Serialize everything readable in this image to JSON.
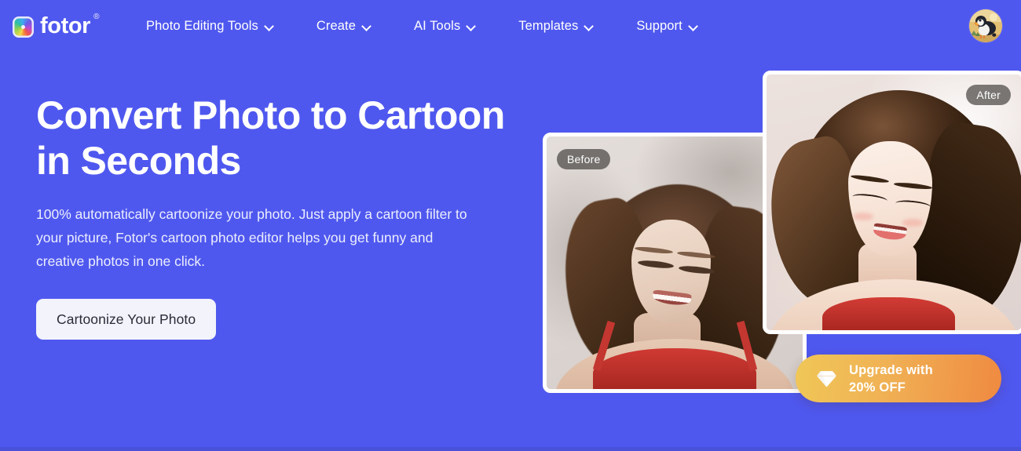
{
  "theme": {
    "background": "#4f58ee",
    "background_bottom_strip": "#4952d8",
    "cta_background": "#f2f3fb",
    "cta_text": "#2b2b38",
    "upgrade_gradient_from": "#f0c757",
    "upgrade_gradient_to": "#ef8a41",
    "badge_background": "rgba(74,70,68,0.72)",
    "card_border": "#ffffff"
  },
  "header": {
    "brand": {
      "logo_icon": "fotor-color-wheel-icon",
      "name": "fotor",
      "registered_mark": "®"
    },
    "nav": [
      {
        "label": "Photo Editing Tools",
        "has_dropdown": true,
        "chevron_icon": "chevron-down-icon"
      },
      {
        "label": "Create",
        "has_dropdown": true,
        "chevron_icon": "chevron-down-icon"
      },
      {
        "label": "AI Tools",
        "has_dropdown": true,
        "chevron_icon": "chevron-down-icon"
      },
      {
        "label": "Templates",
        "has_dropdown": true,
        "chevron_icon": "chevron-down-icon"
      },
      {
        "label": "Support",
        "has_dropdown": true,
        "chevron_icon": "chevron-down-icon"
      }
    ],
    "avatar": {
      "icon": "puffin-bird-avatar-icon",
      "alt": "User profile avatar"
    }
  },
  "hero": {
    "title": "Convert Photo to Cartoon in Seconds",
    "subtitle": "100% automatically cartoonize your photo. Just apply a cartoon filter to your picture, Fotor's cartoon photo editor helps you get funny and creative photos in one click.",
    "cta_label": "Cartoonize Your Photo"
  },
  "showcase": {
    "before": {
      "badge": "Before",
      "image_alt": "Photograph of a smiling woman with wavy brown hair wearing a red top"
    },
    "after": {
      "badge": "After",
      "image_alt": "Cartoon illustration of the same smiling woman with wavy brown hair in a red top"
    }
  },
  "promo": {
    "icon": "diamond-gem-icon",
    "label": "Upgrade with\n20% OFF"
  }
}
